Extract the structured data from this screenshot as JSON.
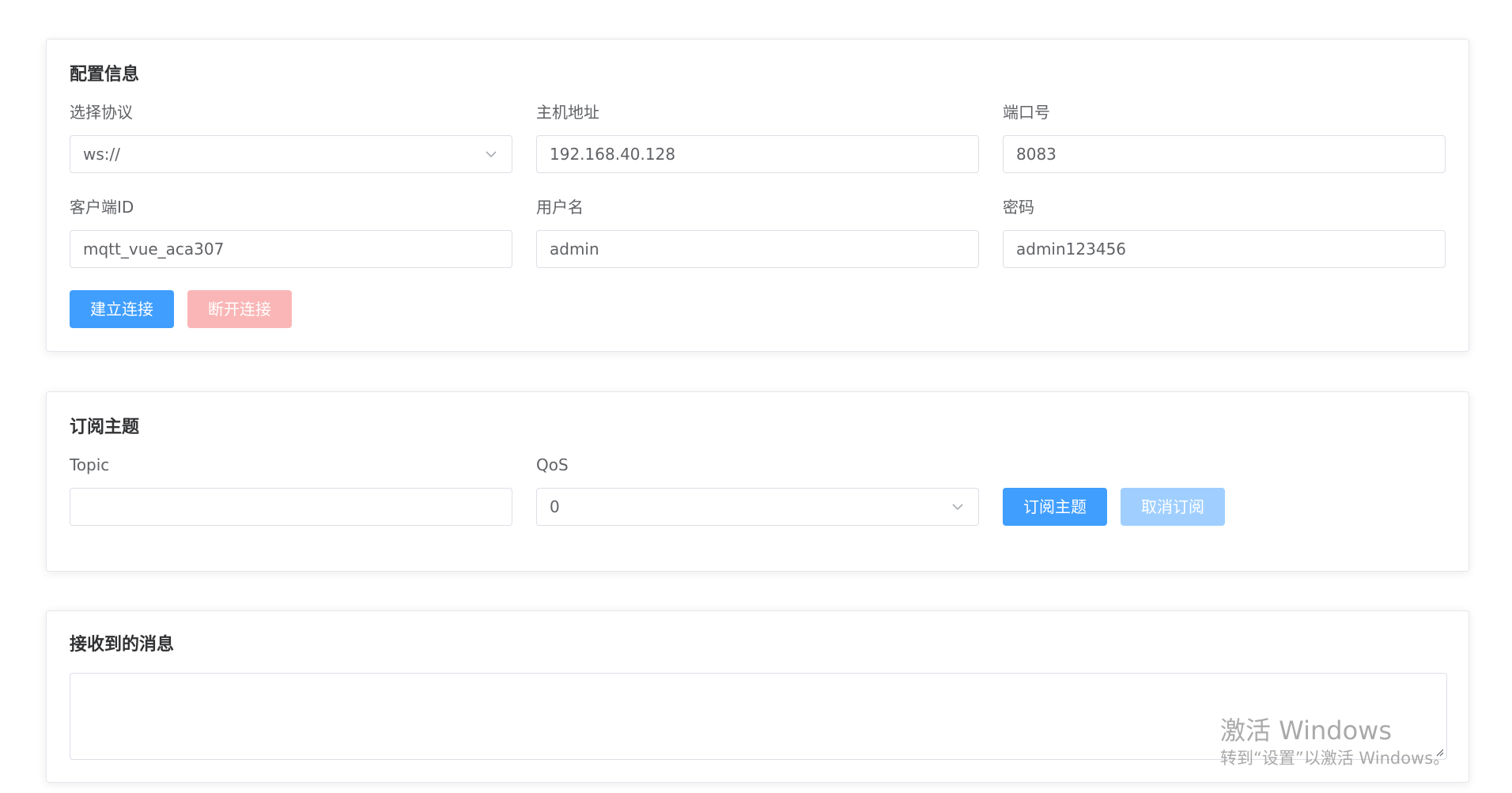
{
  "config": {
    "title": "配置信息",
    "protocol": {
      "label": "选择协议",
      "value": "ws://"
    },
    "host": {
      "label": "主机地址",
      "value": "192.168.40.128"
    },
    "port": {
      "label": "端口号",
      "value": "8083"
    },
    "client_id": {
      "label": "客户端ID",
      "value": "mqtt_vue_aca307"
    },
    "username": {
      "label": "用户名",
      "value": "admin"
    },
    "password": {
      "label": "密码",
      "value": "admin123456"
    },
    "connect_label": "建立连接",
    "disconnect_label": "断开连接"
  },
  "subscribe": {
    "title": "订阅主题",
    "topic": {
      "label": "Topic",
      "value": ""
    },
    "qos": {
      "label": "QoS",
      "value": "0"
    },
    "subscribe_label": "订阅主题",
    "unsubscribe_label": "取消订阅"
  },
  "messages": {
    "title": "接收到的消息",
    "content": ""
  },
  "watermark": {
    "title": "激活 Windows",
    "subtitle": "转到“设置”以激活 Windows。"
  },
  "colors": {
    "primary": "#409eff",
    "danger_disabled": "#fab6b6",
    "primary_disabled": "#a0cfff"
  },
  "icons": {
    "select_arrow": "chevron-down-icon",
    "textarea_resize": "resize-handle-icon"
  }
}
